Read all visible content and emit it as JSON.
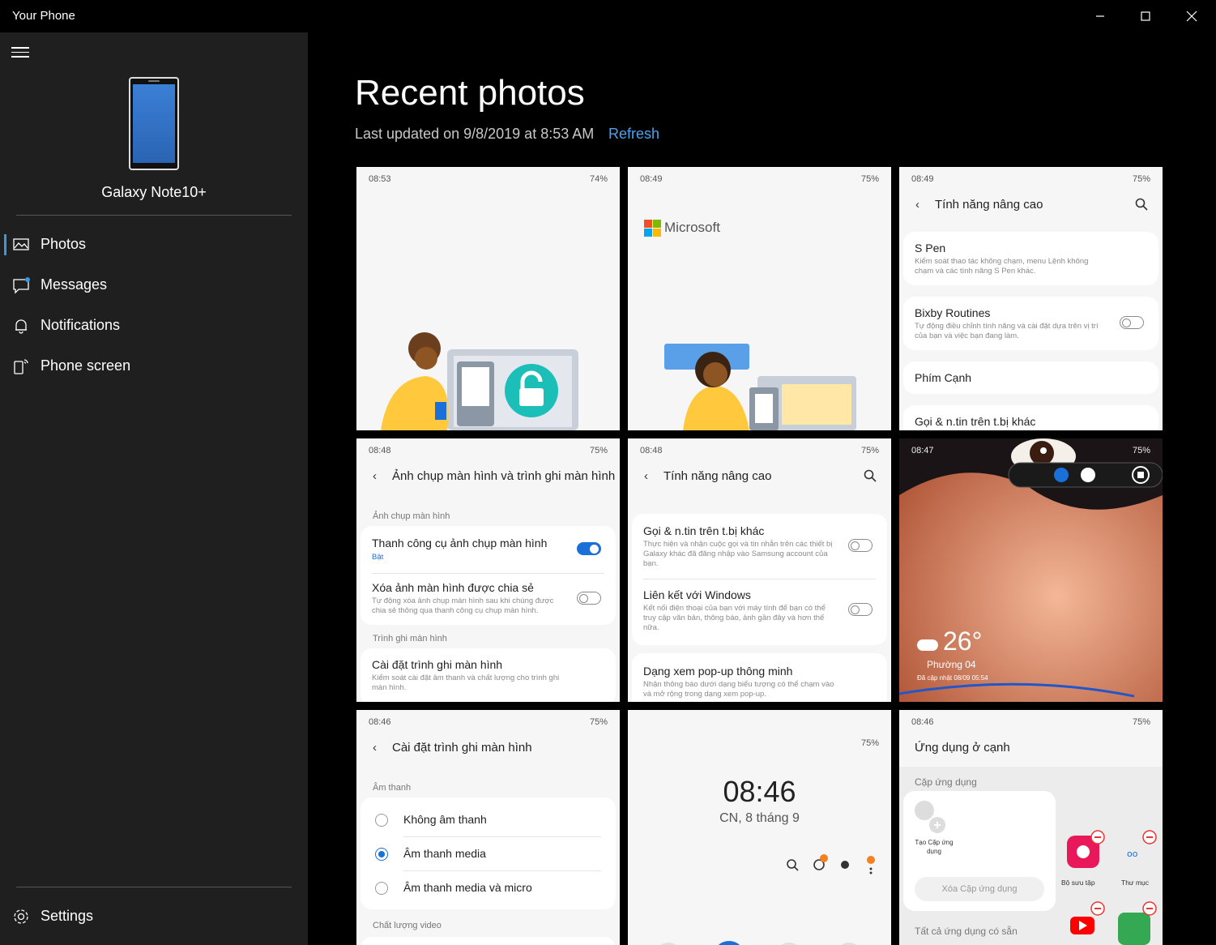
{
  "window": {
    "title": "Your Phone"
  },
  "sidebar": {
    "device_name": "Galaxy Note10+",
    "nav": [
      {
        "label": "Photos",
        "icon": "photos-icon",
        "active": true
      },
      {
        "label": "Messages",
        "icon": "messages-icon"
      },
      {
        "label": "Notifications",
        "icon": "bell-icon"
      },
      {
        "label": "Phone screen",
        "icon": "phone-screen-icon"
      }
    ],
    "settings_label": "Settings"
  },
  "main": {
    "title": "Recent photos",
    "last_updated": "Last updated on 9/8/2019 at 8:53 AM",
    "refresh_label": "Refresh"
  },
  "photos": [
    {
      "time": "08:53",
      "battery": "74%"
    },
    {
      "time": "08:49",
      "battery": "75%",
      "brand": "Microsoft"
    },
    {
      "time": "08:49",
      "battery": "75%",
      "header": "Tính năng nâng cao",
      "items": [
        {
          "title": "S Pen",
          "sub": "Kiểm soát thao tác không chạm, menu Lệnh không chạm và các tính năng S Pen khác."
        },
        {
          "title": "Bixby Routines",
          "sub": "Tự động điều chỉnh tính năng và cài đặt dựa trên vị trí của bạn và việc bạn đang làm."
        },
        {
          "title": "Phím Cạnh",
          "sub": ""
        },
        {
          "title": "Gọi & n.tin trên t.bị khác",
          "sub": ""
        }
      ]
    },
    {
      "time": "08:48",
      "battery": "75%",
      "header": "Ảnh chụp màn hình và trình ghi màn hình",
      "section1": "Ảnh chụp màn hình",
      "items": [
        {
          "title": "Thanh công cụ ảnh chụp màn hình",
          "sub": "Bật"
        },
        {
          "title": "Xóa ảnh màn hình được chia sẻ",
          "sub": "Tự động xóa ảnh chụp màn hình sau khi chúng được chia sẻ thông qua thanh công cụ chụp màn hình."
        }
      ],
      "section2": "Trình ghi màn hình",
      "item3": {
        "title": "Cài đặt trình ghi màn hình",
        "sub": "Kiểm soát cài đặt âm thanh và chất lượng cho trình ghi màn hình."
      }
    },
    {
      "time": "08:48",
      "battery": "75%",
      "header": "Tính năng nâng cao",
      "items": [
        {
          "title": "Gọi & n.tin trên t.bị khác",
          "sub": "Thực hiện và nhận cuộc gọi và tin nhắn trên các thiết bị Galaxy khác đã đăng nhập vào Samsung account của bạn."
        },
        {
          "title": "Liên kết với Windows",
          "sub": "Kết nối điện thoại của bạn với máy tính để bạn có thể truy cập văn bản, thông báo, ảnh gần đây và hơn thế nữa."
        },
        {
          "title": "Dạng xem pop-up thông minh",
          "sub": "Nhận thông báo dưới dạng biểu tượng có thể chạm vào và mở rộng trong dạng xem pop-up."
        }
      ]
    },
    {
      "time": "08:47",
      "battery": "75%",
      "temp": "26°",
      "location": "Phường 04",
      "weather_updated": "Đã cập nhật 08/09 05:54"
    },
    {
      "time": "08:46",
      "battery": "75%",
      "header": "Cài đặt trình ghi màn hình",
      "section1": "Âm thanh",
      "options": [
        "Không âm thanh",
        "Âm thanh media",
        "Âm thanh media và micro"
      ],
      "selected": 1,
      "section2": "Chất lượng video"
    },
    {
      "battery": "75%",
      "clock": "08:46",
      "date": "CN, 8 tháng 9"
    },
    {
      "time": "08:46",
      "battery": "75%",
      "header": "Ứng dụng ở cạnh",
      "section1": "Cặp ứng dụng",
      "create_pair": "Tạo Cặp ứng dụng",
      "delete_pair": "Xóa Cặp ứng dụng",
      "section2": "Tất cả ứng dụng có sẵn",
      "apps": [
        "Bộ sưu tập",
        "Thư mục"
      ]
    }
  ]
}
